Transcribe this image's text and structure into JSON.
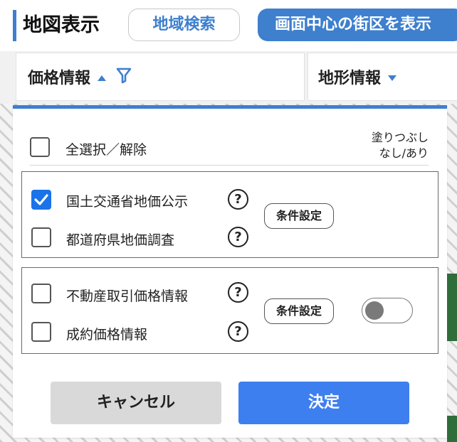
{
  "header": {
    "title": "地図表示",
    "region_search_label": "地域検索",
    "center_block_label": "画面中心の街区を表示"
  },
  "tabs": [
    {
      "label": "価格情報",
      "sort_icon": "caret-up-icon",
      "filter_icon": "filter-icon"
    },
    {
      "label": "地形情報",
      "sort_icon": "caret-down-icon"
    }
  ],
  "panel": {
    "select_all_label": "全選択／解除",
    "fill_column_label_line1": "塗りつぶし",
    "fill_column_label_line2": "なし/あり",
    "groups": [
      {
        "items": [
          {
            "label": "国土交通省地価公示",
            "checked": true,
            "help": "?"
          },
          {
            "label": "都道府県地価調査",
            "checked": false,
            "help": "?"
          }
        ],
        "condition_button_label": "条件設定"
      },
      {
        "items": [
          {
            "label": "不動産取引価格情報",
            "checked": false,
            "help": "?"
          },
          {
            "label": "成約価格情報",
            "checked": false,
            "help": "?"
          }
        ],
        "condition_button_label": "条件設定",
        "fill_toggle_on": false
      }
    ],
    "cancel_label": "キャンセル",
    "ok_label": "決定"
  },
  "colors": {
    "accent": "#3e7fce",
    "checkbox_checked": "#1a73e8",
    "ok_button": "#3e7fef",
    "cancel_button": "#d9d9d9"
  }
}
